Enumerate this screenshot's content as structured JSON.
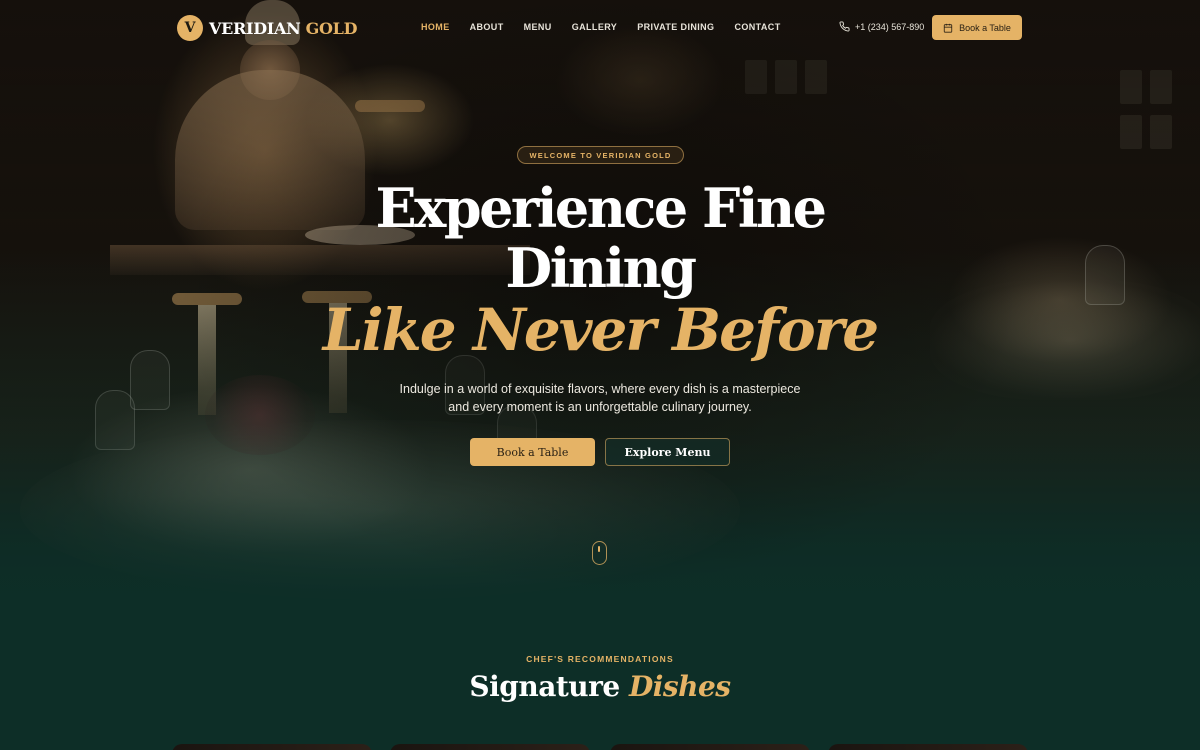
{
  "colors": {
    "accent": "#e5b366",
    "background": "#0d2e27",
    "text": "#ffffff"
  },
  "brand": {
    "badge_letter": "V",
    "name_part1": "VERIDIAN",
    "name_part2": "GOLD"
  },
  "nav": {
    "links": [
      {
        "label": "HOME",
        "active": true
      },
      {
        "label": "ABOUT",
        "active": false
      },
      {
        "label": "MENU",
        "active": false
      },
      {
        "label": "GALLERY",
        "active": false
      },
      {
        "label": "PRIVATE DINING",
        "active": false
      },
      {
        "label": "CONTACT",
        "active": false
      }
    ],
    "phone": "+1 (234) 567-890",
    "phone_icon": "phone-icon",
    "cta_label": "Book a Table",
    "cta_icon": "calendar-icon"
  },
  "hero": {
    "eyebrow": "WELCOME TO VERIDIAN GOLD",
    "headline_line1": "Experience Fine",
    "headline_line2": "Dining",
    "headline_line3": "Like Never Before",
    "subtext_line1": "Indulge in a world of exquisite flavors, where every dish is a masterpiece",
    "subtext_line2": "and every moment is an unforgettable culinary journey.",
    "primary_button": "Book a Table",
    "secondary_button": "Explore Menu",
    "scroll_icon": "mouse-scroll-icon"
  },
  "signature": {
    "eyebrow": "CHEF'S RECOMMENDATIONS",
    "title_part1": "Signature",
    "title_part2": "Dishes"
  }
}
